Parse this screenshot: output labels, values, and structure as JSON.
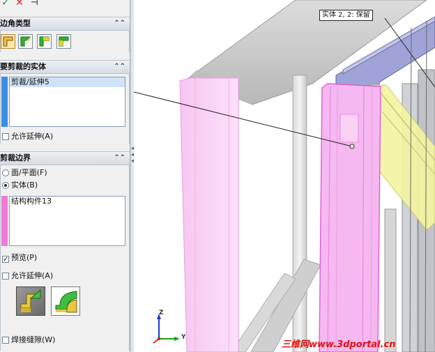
{
  "panel": {
    "top_icons": [
      "ok-check-icon",
      "cancel-x-icon",
      "pin-icon"
    ],
    "corner_type": {
      "title": "边角类型",
      "buttons": [
        "corner-end-trim",
        "corner-miter",
        "corner-end-butt1",
        "corner-end-butt2"
      ]
    },
    "bodies_to_trim": {
      "title": "要剪裁的实体",
      "items": [
        "剪裁/延伸5"
      ],
      "allow_extend_label": "允许延伸(A)",
      "allow_extend_checked": false
    },
    "trim_boundary": {
      "title": "剪裁边界",
      "option_face_label": "面/平面(F)",
      "option_body_label": "实体(B)",
      "selected_option": "body",
      "items": [
        "结构构件13"
      ],
      "preview_label": "预览(P)",
      "preview_checked": true,
      "allow_extend_label": "允许延伸(A)",
      "allow_extend_checked": false,
      "weld_gap_label": "焊接缝隙(W)",
      "weld_gap_checked": false
    }
  },
  "viewport": {
    "callout": "实体 2,  2:  保留",
    "watermark": "三维网www.3dportal.cn",
    "triad": {
      "z_label": "Z",
      "y_label": "Y"
    }
  },
  "colors": {
    "pink_body": "#f0b8f0",
    "yellow_body": "#f5f5a0",
    "blue_body": "#9fa3d8",
    "gray_frame": "#c9c9c9"
  }
}
